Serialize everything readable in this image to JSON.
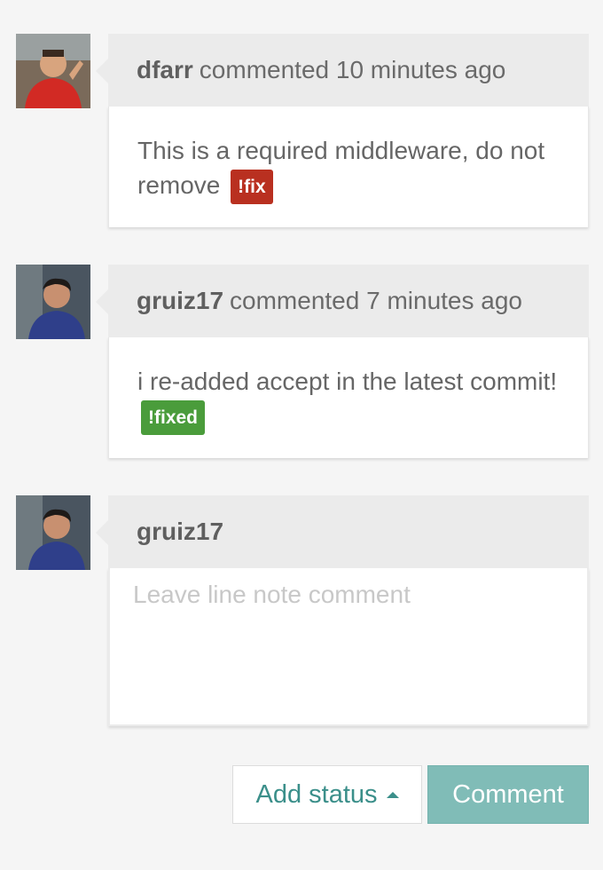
{
  "comments": [
    {
      "author": "dfarr",
      "action": "commented",
      "time": "10 minutes ago",
      "body": "This is a required middleware, do not remove",
      "tag": "!fix",
      "tag_color": "#b93020"
    },
    {
      "author": "gruiz17",
      "action": "commented",
      "time": "7 minutes ago",
      "body": "i re-added accept in the latest commit!",
      "tag": "!fixed",
      "tag_color": "#4a9c3b"
    }
  ],
  "new_comment": {
    "author": "gruiz17",
    "placeholder": "Leave line note comment"
  },
  "actions": {
    "add_status_label": "Add status",
    "add_status_icon": "caret-up-icon",
    "comment_label": "Comment"
  },
  "colors": {
    "accent": "#3b8f8a",
    "comment_button": "#80bcb7",
    "header_bg": "#ebebeb"
  }
}
